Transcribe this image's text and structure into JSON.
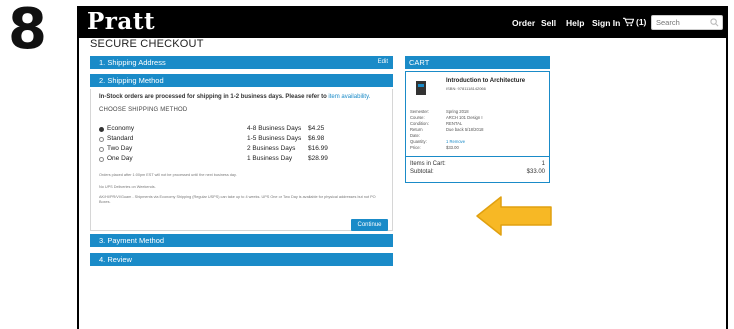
{
  "step_number": "8",
  "header": {
    "logo": "Pratt",
    "nav": [
      "Order",
      "Sell",
      "Help",
      "Sign In"
    ],
    "cart_label": "(1)",
    "search_placeholder": "Search"
  },
  "checkout": {
    "title": "SECURE CHECKOUT",
    "sections": [
      {
        "label": "1. Shipping Address",
        "action": "Edit"
      },
      {
        "label": "2. Shipping Method"
      },
      {
        "label": "3. Payment Method"
      },
      {
        "label": "4. Review"
      }
    ],
    "shipping": {
      "lead": "In-Stock orders are processed for shipping in 1-2 business days. Please refer to",
      "lead_link": "item availability.",
      "heading": "CHOOSE SHIPPING METHOD",
      "options": [
        {
          "name": "Economy",
          "days": "4-8 Business Days",
          "price": "$4.25",
          "selected": true
        },
        {
          "name": "Standard",
          "days": "1-5 Business Days",
          "price": "$6.98",
          "selected": false
        },
        {
          "name": "Two Day",
          "days": "2 Business Days",
          "price": "$16.99",
          "selected": false
        },
        {
          "name": "One Day",
          "days": "1 Business Day",
          "price": "$28.99",
          "selected": false
        }
      ],
      "notes": [
        "Orders placed after 1:00pm EST will not be processed until the next business day.",
        "No UPS Deliveries on Weekends.",
        "AK/HI/PR/VI/Guam - Shipments via Economy Shipping (Regular USPS) can take up to 4 weeks. UPS One or Two Day is available for physical addresses but not PO Boxes."
      ],
      "continue_label": "Continue"
    }
  },
  "cart": {
    "heading": "CART",
    "item": {
      "title": "Introduction to Architecture",
      "isbn": "ISBN: 9781118142066",
      "details": [
        {
          "key": "Semester:",
          "value": "Spring 2018"
        },
        {
          "key": "Course:",
          "value": "ARCH 101 Design I"
        },
        {
          "key": "Condition:",
          "value": "RENTAL"
        },
        {
          "key": "Return",
          "value": "Due back 5/18/2018"
        },
        {
          "key": "Date:",
          "value": ""
        },
        {
          "key": "Quantity:",
          "value": "1 Remove"
        },
        {
          "key": "Price:",
          "value": "$33.00"
        }
      ]
    },
    "summary": [
      {
        "label": "Items in Cart:",
        "value": "1"
      },
      {
        "label": "Subtotal:",
        "value": "$33.00"
      }
    ]
  },
  "colors": {
    "accent": "#1a8bc8",
    "arrow": "#f7b825",
    "topbar": "#000000"
  },
  "icons": [
    "cart-icon",
    "search-icon",
    "pointer-arrow-icon"
  ]
}
